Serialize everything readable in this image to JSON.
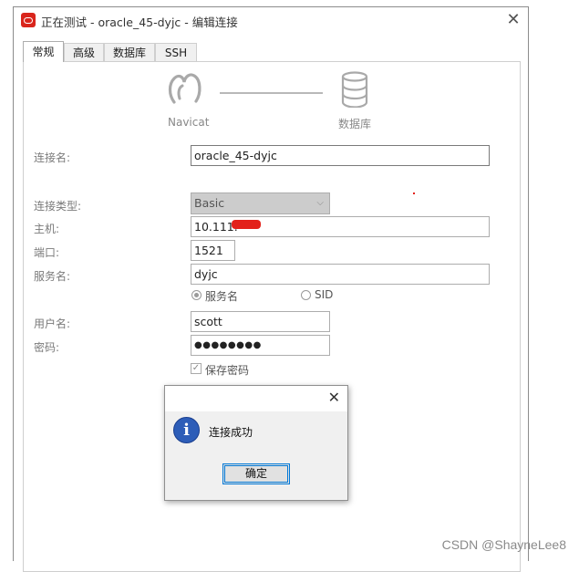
{
  "window": {
    "title": "正在测试 - oracle_45-dyjc - 编辑连接",
    "close_glyph": "✕"
  },
  "tabs": [
    {
      "label": "常规",
      "active": true
    },
    {
      "label": "高级",
      "active": false
    },
    {
      "label": "数据库",
      "active": false
    },
    {
      "label": "SSH",
      "active": false
    }
  ],
  "diagram": {
    "left_label": "Navicat",
    "right_label": "数据库",
    "left_icon": "navicat-logo-icon",
    "right_icon": "database-icon"
  },
  "form": {
    "connection_name_label": "连接名:",
    "connection_name_value": "oracle_45-dyjc",
    "connection_type_label": "连接类型:",
    "connection_type_value": "Basic",
    "host_label": "主机:",
    "host_value": "10.111.",
    "port_label": "端口:",
    "port_value": "1521",
    "service_name_label": "服务名:",
    "service_name_value": "dyjc",
    "radio_service_name": "服务名",
    "radio_sid": "SID",
    "username_label": "用户名:",
    "username_value": "scott",
    "password_label": "密码:",
    "password_value": "●●●●●●●●",
    "save_password_label": "保存密码",
    "save_password_checked": true
  },
  "dialog": {
    "message": "连接成功",
    "ok_label": "确定",
    "close_glyph": "✕",
    "icon": "info-icon"
  },
  "watermark": "CSDN @ShayneLee8",
  "colors": {
    "brand": "#d9251c",
    "focus": "#0078d7",
    "info": "#2d5db8"
  }
}
